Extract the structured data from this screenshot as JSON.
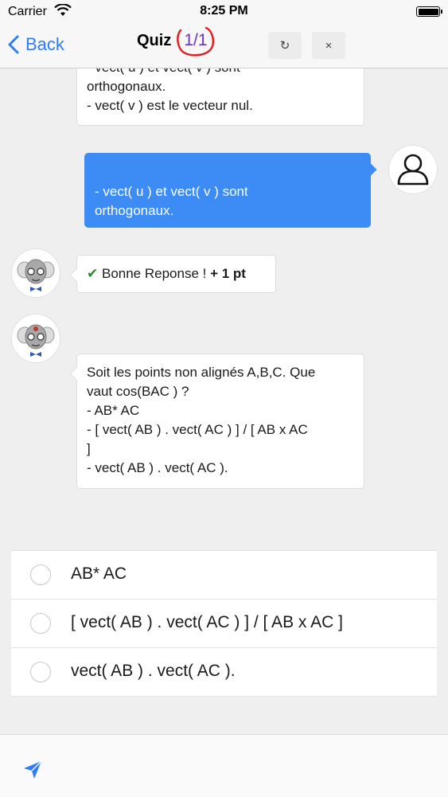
{
  "status_bar": {
    "carrier": "Carrier",
    "time": "8:25 PM"
  },
  "nav": {
    "back_label": "Back",
    "title": "Quiz",
    "counter": "1/1",
    "refresh_symbol": "↻",
    "close_symbol": "×"
  },
  "messages": {
    "bot_partial": [
      "- vect( u ) et vect( v ) sont",
      "orthogonaux.",
      "- vect( v ) est le vecteur nul."
    ],
    "user_answer": [
      "- vect( u ) et vect( v ) sont",
      "orthogonaux."
    ],
    "feedback": {
      "check": "✔",
      "text": "Bonne Reponse ! ",
      "points": "+ 1 pt"
    },
    "question": [
      "Soit les points non alignés A,B,C. Que",
      "vaut cos(BAC ) ?",
      "- AB* AC",
      "- [ vect( AB ) . vect( AC ) ] / [ AB x AC",
      "]",
      "- vect( AB ) . vect( AC )."
    ]
  },
  "options": [
    {
      "label": "AB* AC"
    },
    {
      "label": "[ vect( AB ) . vect( AC ) ] / [ AB x AC ]"
    },
    {
      "label": "vect( AB ) . vect( AC )."
    }
  ],
  "colors": {
    "accent": "#2e7cf6",
    "user_bubble": "#3d8bf5",
    "counter": "#6a32c9",
    "counter_ring": "#e02020",
    "check": "#2a8a2a"
  }
}
